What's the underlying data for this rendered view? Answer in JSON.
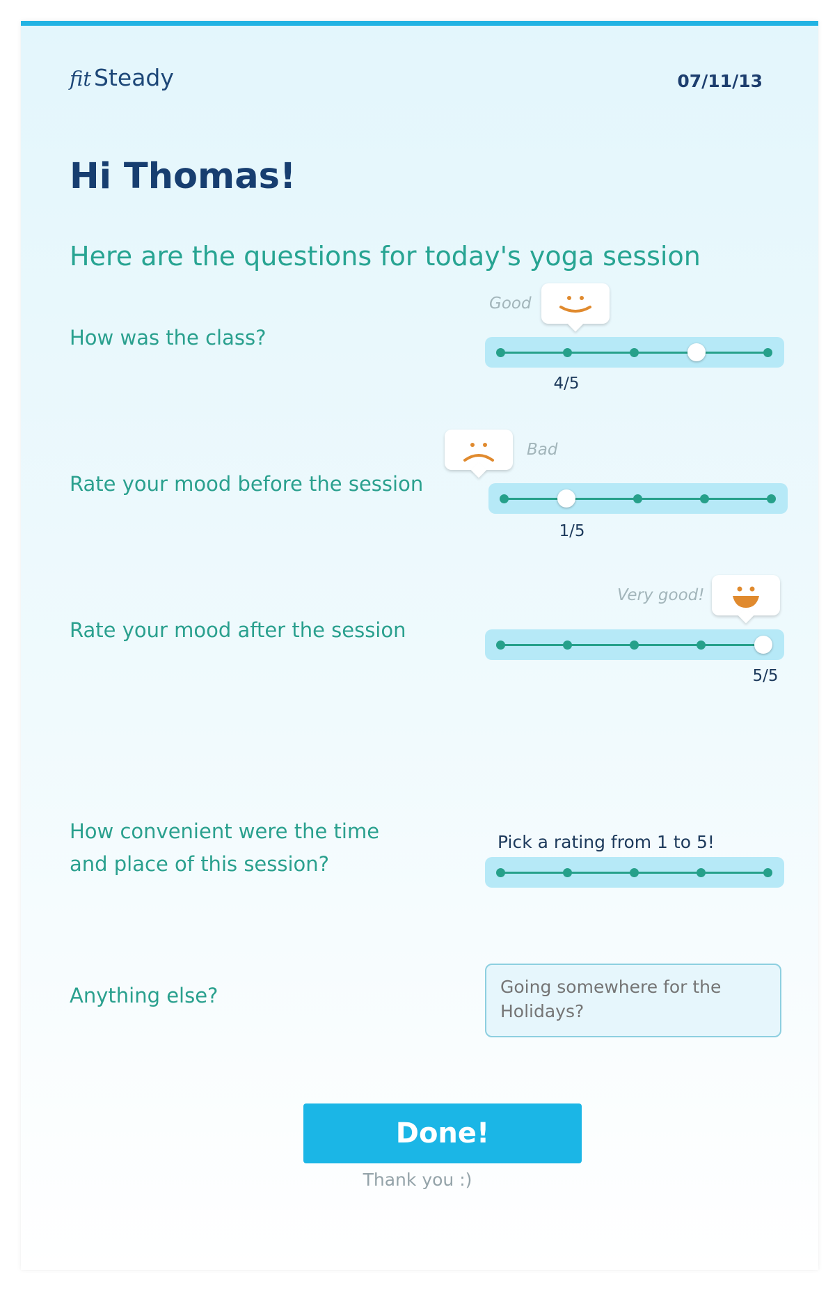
{
  "header": {
    "logo_prefix": "fit",
    "logo_name": "Steady",
    "date": "07/11/13"
  },
  "greeting": "Hi Thomas!",
  "subtitle": "Here are the questions for today's yoga session",
  "questions": [
    {
      "label": "How was the class?",
      "rating": 4,
      "max": 5,
      "value_text": "4/5",
      "mood_text": "Good",
      "face": "smile-face-icon"
    },
    {
      "label": "Rate your mood before the session",
      "rating": 1,
      "max": 5,
      "value_text": "1/5",
      "mood_text": "Bad",
      "face": "frown-face-icon"
    },
    {
      "label": "Rate your mood after the session",
      "rating": 5,
      "max": 5,
      "value_text": "5/5",
      "mood_text": "Very good!",
      "face": "big-smile-face-icon"
    },
    {
      "label_line1": "How convenient were the time",
      "label_line2": "and place of this session?",
      "rating": null,
      "max": 5,
      "prompt": "Pick a rating from 1 to 5!"
    }
  ],
  "anything_else": {
    "label": "Anything else?",
    "placeholder": "Going somewhere for the Holidays?"
  },
  "done_label": "Done!",
  "thanks": "Thank you :)",
  "colors": {
    "accent": "#1bb6e6",
    "teal": "#2aa08e",
    "navy": "#173e70",
    "face": "#e08a2e"
  }
}
